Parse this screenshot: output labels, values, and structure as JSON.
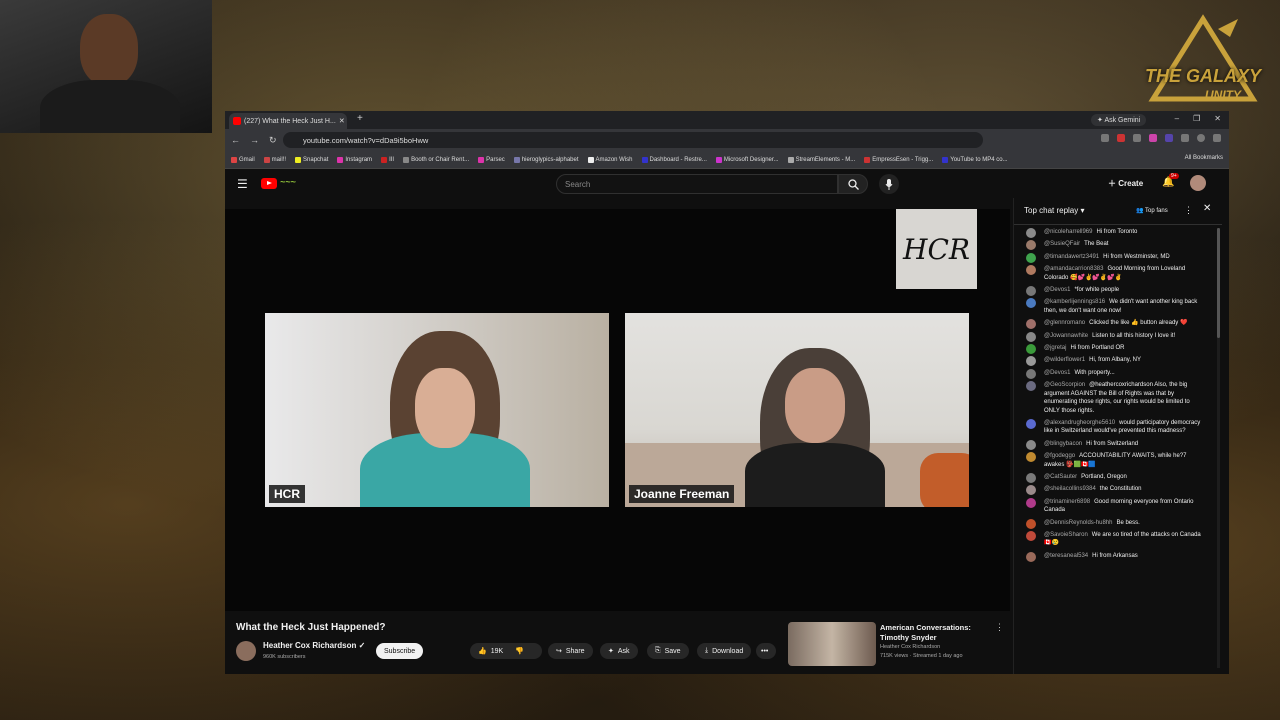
{
  "overlay": {
    "logo_line1": "THE GALAXY",
    "logo_line2": "UNITY"
  },
  "browser": {
    "tab_title": "(227) What the Heck Just H...",
    "ask_gemini": "Ask Gemini",
    "url": "youtube.com/watch?v=dDa9i5boHww",
    "bookmarks": [
      "Gmail",
      "mail!!",
      "Snapchat",
      "Instagram",
      "III",
      "Booth or Chair Rent...",
      "Parsec",
      "hieroglypics-alphabet",
      "Amazon Wish",
      "Dashboard - Restre...",
      "Microsoft Designer...",
      "StreamElements - M...",
      "EmpressEsen - Trigg...",
      "YouTube to MP4 co..."
    ],
    "all_bookmarks": "All Bookmarks"
  },
  "youtube": {
    "search_placeholder": "Search",
    "create_label": "Create",
    "notif_count": "9+"
  },
  "video": {
    "participant1": "HCR",
    "participant2": "Joanne Freeman",
    "title": "What the Heck Just Happened?",
    "channel": "Heather Cox Richardson",
    "subscribers": "960K subscribers",
    "subscribe": "Subscribe",
    "likes": "19K",
    "share": "Share",
    "ask": "Ask",
    "save": "Save",
    "download": "Download"
  },
  "recommended": {
    "title": "American Conversations: Timothy Snyder",
    "channel": "Heather Cox Richardson",
    "meta": "715K views · Streamed 1 day ago"
  },
  "chat": {
    "header": "Top chat replay",
    "top_fans": "Top fans",
    "messages": [
      {
        "author": "@nicoleharrell969",
        "text": "Hi from Toronto",
        "color": "#8a8a8a"
      },
      {
        "author": "@SusieQFair",
        "text": "The Beat",
        "color": "#9a7a6a"
      },
      {
        "author": "@timandawertz3491",
        "text": "Hi from Westminster, MD",
        "color": "#3fa34d"
      },
      {
        "author": "@amandacarrion8383",
        "text": "Good Morning from Loveland Colorado 🥰💕✌️💕✌️💕✌️",
        "color": "#b07a60"
      },
      {
        "author": "@Devos1",
        "text": "*for white people",
        "color": "#777"
      },
      {
        "author": "@kamberlijennings816",
        "text": "We didn't want another king back then, we don't want one now!",
        "color": "#4a7ac0"
      },
      {
        "author": "@glennromano",
        "text": "Clicked the like 👍 button already ❤️",
        "color": "#a0706a"
      },
      {
        "author": "@Jowannawhite",
        "text": "Listen to all this history I love it!",
        "color": "#888"
      },
      {
        "author": "@jgretaj",
        "text": "Hi from Portland OR",
        "color": "#3a9a3a"
      },
      {
        "author": "@wilderflower1",
        "text": "Hi, from Albany, NY",
        "color": "#999"
      },
      {
        "author": "@Devos1",
        "text": "With property...",
        "color": "#777"
      },
      {
        "author": "@GeoScorpion",
        "text": "@heathercoxrichardson Also, the big argument AGAINST the Bill of Rights was that by enumerating those rights, our rights would be limited to ONLY those rights.",
        "color": "#6a6a80"
      },
      {
        "author": "@alexandrugheorghe5610",
        "text": "would participatory democracy like in Switzerland would've prevented this madness?",
        "color": "#5a6ad0"
      },
      {
        "author": "@blingybacon",
        "text": "Hi from Switzerland",
        "color": "#8a8a8a"
      },
      {
        "author": "@fgodeggo",
        "text": "ACCOUNTABILITY AWAITS, while he?7 awakes 👺🟩🇨🇦🟦",
        "color": "#c08a30"
      },
      {
        "author": "@CatSauter",
        "text": "Portland, Oregon",
        "color": "#7a7a7a"
      },
      {
        "author": "@sheilacollins9384",
        "text": "the Constitution",
        "color": "#9a8a8a"
      },
      {
        "author": "@trinaminer6898",
        "text": "Good morning everyone from Ontario Canada",
        "color": "#b03a8a"
      },
      {
        "author": "@DennisReynolds-hu8hh",
        "text": "Be bess.",
        "color": "#c0502a"
      },
      {
        "author": "@SavoieSharon",
        "text": "We are so tired of the attacks on Canada 🇨🇦😢",
        "color": "#c04a3a"
      },
      {
        "author": "@teresaneal534",
        "text": "Hi from Arkansas",
        "color": "#9a6a5a"
      }
    ]
  }
}
